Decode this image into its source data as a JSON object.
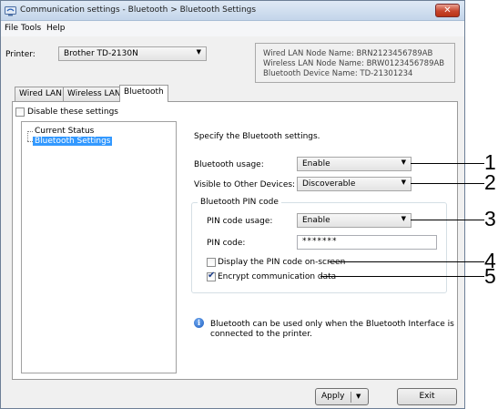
{
  "window": {
    "title": "Communication settings - Bluetooth > Bluetooth Settings",
    "close_symbol": "✕"
  },
  "menu": {
    "file": "File",
    "tools": "Tools",
    "help": "Help"
  },
  "printer": {
    "label": "Printer:",
    "selected": "Brother TD-2130N"
  },
  "node_info": {
    "wired": "Wired LAN Node Name: BRN2123456789AB",
    "wireless": "Wireless LAN Node Name: BRW0123456789AB",
    "bluetooth": "Bluetooth Device Name: TD-21301234"
  },
  "tabs": [
    {
      "label": "Wired LAN"
    },
    {
      "label": "Wireless LAN"
    },
    {
      "label": "Bluetooth"
    }
  ],
  "disable_settings": {
    "label": "Disable these settings",
    "checked": false
  },
  "tree": {
    "items": [
      "Current Status",
      "Bluetooth Settings"
    ],
    "selected": "Bluetooth Settings"
  },
  "main": {
    "heading": "Specify the Bluetooth settings.",
    "usage_label": "Bluetooth usage:",
    "usage_value": "Enable",
    "visible_label": "Visible to Other Devices:",
    "visible_value": "Discoverable",
    "pin_group_title": "Bluetooth PIN code",
    "pin_usage_label": "PIN code usage:",
    "pin_usage_value": "Enable",
    "pin_code_label": "PIN code:",
    "pin_code_value": "*******",
    "display_pin_label": "Display the PIN code on-screen",
    "display_pin_checked": false,
    "encrypt_label": "Encrypt communication data",
    "encrypt_checked": true,
    "note_line1": "Bluetooth can be used only when the Bluetooth Interface is",
    "note_line2": "connected to the printer."
  },
  "buttons": {
    "apply": "Apply",
    "exit": "Exit"
  },
  "callouts": [
    "1",
    "2",
    "3",
    "4",
    "5"
  ]
}
